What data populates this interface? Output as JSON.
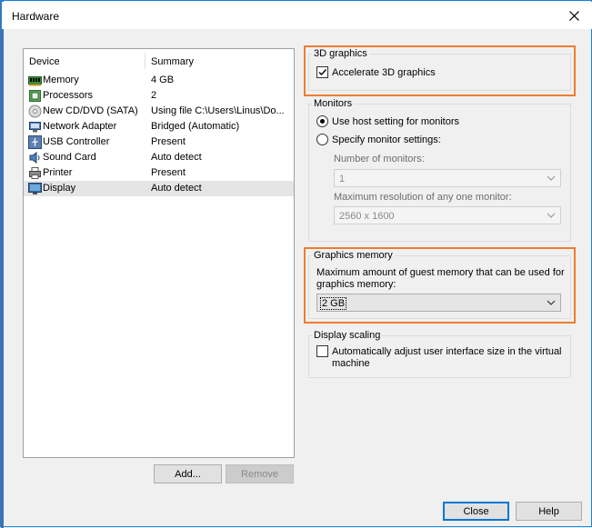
{
  "window": {
    "title": "Hardware"
  },
  "devices": {
    "header": {
      "device": "Device",
      "summary": "Summary"
    },
    "items": [
      {
        "name": "Memory",
        "summary": "4 GB",
        "icon": "memory-icon"
      },
      {
        "name": "Processors",
        "summary": "2",
        "icon": "processor-icon"
      },
      {
        "name": "New CD/DVD (SATA)",
        "summary": "Using file C:\\Users\\Linus\\Do...",
        "icon": "cd-dvd-icon"
      },
      {
        "name": "Network Adapter",
        "summary": "Bridged (Automatic)",
        "icon": "network-adapter-icon"
      },
      {
        "name": "USB Controller",
        "summary": "Present",
        "icon": "usb-controller-icon"
      },
      {
        "name": "Sound Card",
        "summary": "Auto detect",
        "icon": "sound-card-icon"
      },
      {
        "name": "Printer",
        "summary": "Present",
        "icon": "printer-icon"
      },
      {
        "name": "Display",
        "summary": "Auto detect",
        "icon": "display-icon",
        "selected": true
      }
    ],
    "add_label": "Add...",
    "remove_label": "Remove"
  },
  "graphics3d": {
    "group_label": "3D graphics",
    "accelerate_label": "Accelerate 3D graphics",
    "accelerate_checked": true
  },
  "monitors": {
    "group_label": "Monitors",
    "use_host_label": "Use host setting for monitors",
    "specify_label": "Specify monitor settings:",
    "selected_option": "use_host",
    "number_label": "Number of monitors:",
    "number_value": "1",
    "max_res_label": "Maximum resolution of any one monitor:",
    "max_res_value": "2560 x 1600"
  },
  "graphics_memory": {
    "group_label": "Graphics memory",
    "description_line1": "Maximum amount of guest memory that can be used for",
    "description_line2": "graphics memory:",
    "value": "2 GB"
  },
  "display_scaling": {
    "group_label": "Display scaling",
    "auto_adjust_line1": "Automatically adjust user interface size in the virtual",
    "auto_adjust_line2": "machine",
    "auto_adjust_checked": false
  },
  "footer": {
    "close_label": "Close",
    "help_label": "Help"
  },
  "colors": {
    "highlight": "#ed7d31",
    "accent": "#0078d7"
  }
}
